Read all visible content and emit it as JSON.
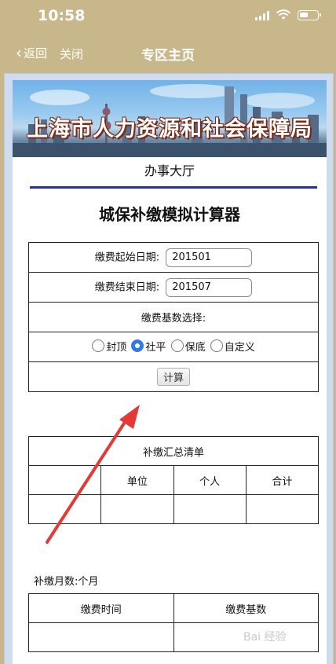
{
  "status_bar": {
    "time": "10:58"
  },
  "nav": {
    "back_label": "返回",
    "close_label": "关闭",
    "title": "专区主页"
  },
  "banner": {
    "text": "上海市人力资源和社会保障局"
  },
  "hall": {
    "label": "办事大厅"
  },
  "calculator": {
    "title": "城保补缴模拟计算器",
    "start_label": "缴费起始日期:",
    "start_value": "201501",
    "end_label": "缴费结束日期:",
    "end_value": "201507",
    "base_label": "缴费基数选择:",
    "options": [
      "封顶",
      "社平",
      "保底",
      "自定义"
    ],
    "selected_option": "社平",
    "calc_button": "计算"
  },
  "summary": {
    "title": "补缴汇总清单",
    "columns": [
      "",
      "单位",
      "个人",
      "合计"
    ]
  },
  "months": {
    "label": "补缴月数:",
    "unit": "个月"
  },
  "time_table": {
    "columns": [
      "缴费时间",
      "缴费基数"
    ]
  },
  "watermark": "Bai 经验",
  "colors": {
    "nav_bg": "#c8b78a",
    "accent_line": "#1f2fbf",
    "arrow": "#e53935",
    "radio_selected": "#2f7ae5"
  }
}
